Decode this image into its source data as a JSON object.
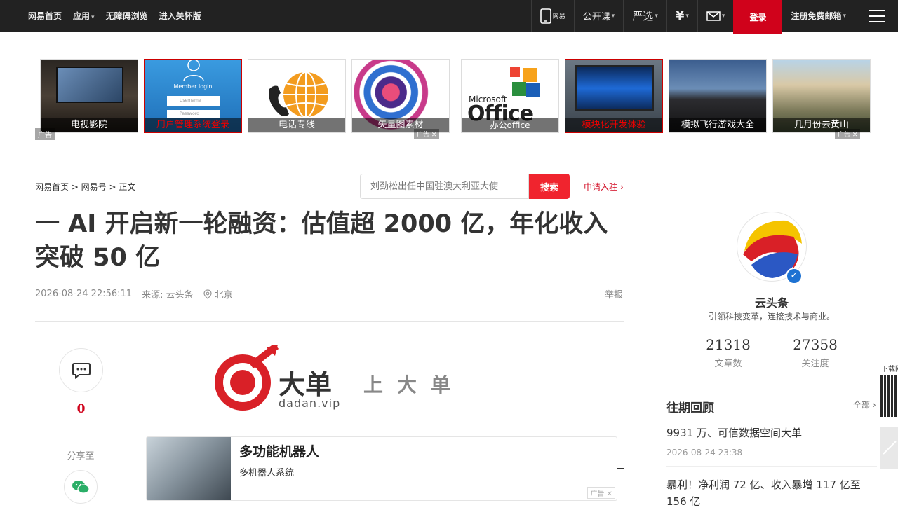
{
  "topbar": {
    "left": [
      {
        "label": "网易首页"
      },
      {
        "label": "应用"
      },
      {
        "label": "无障碍浏览"
      },
      {
        "label": "进入关怀版"
      }
    ],
    "right": {
      "mobile_label": "网易",
      "open_course": "公开课",
      "yanxuan": "严选",
      "login": "登录",
      "register": "注册免费邮箱"
    }
  },
  "ads": [
    {
      "label": "电视影院",
      "ad_tag": "广告"
    },
    {
      "label": "用户管理系统登录",
      "login_title": "Member login",
      "username": "Username",
      "password": "Password"
    },
    {
      "label": "电话专线"
    },
    {
      "label": "矢量图素材",
      "ad_tag": "广告"
    },
    {
      "label": "办公office",
      "brand_small": "Microsoft",
      "brand_big": "Office"
    },
    {
      "label": "模块化开发体验"
    },
    {
      "label": "模拟飞行游戏大全"
    },
    {
      "label": "几月份去黄山",
      "ad_tag": "广告"
    }
  ],
  "breadcrumb": "网易首页 > 网易号 > 正文",
  "search": {
    "placeholder": "刘劲松出任中国驻澳大利亚大使",
    "button": "搜索"
  },
  "apply_link": "申请入驻",
  "article": {
    "title": "一 AI 开启新一轮融资：估值超 2000 亿，年化收入突破 50 亿",
    "datetime": "2026-08-24 22:56:11",
    "source": "来源: 云头条",
    "location": "北京",
    "report": "举报"
  },
  "rail": {
    "comment_count": "0",
    "share_label": "分享至"
  },
  "banner": {
    "brand": "大单",
    "domain": "dadan.vip",
    "slogan": "上大单"
  },
  "ad_card": {
    "title": "多功能机器人",
    "subtitle": "多机器人系统",
    "tag": "广告"
  },
  "author": {
    "name": "云头条",
    "desc": "引领科技变革，连接技术与商业。",
    "articles_count": "21318",
    "articles_label": "文章数",
    "followers_count": "27358",
    "followers_label": "关注度"
  },
  "history": {
    "title": "往期回顾",
    "all": "全部",
    "items": [
      {
        "title": "9931 万、可信数据空间大单",
        "date": "2026-08-24 23:38"
      },
      {
        "title": "暴利！净利润 72 亿、收入暴增 117 亿至 156 亿"
      }
    ]
  },
  "side": {
    "download_label": "下载网"
  }
}
